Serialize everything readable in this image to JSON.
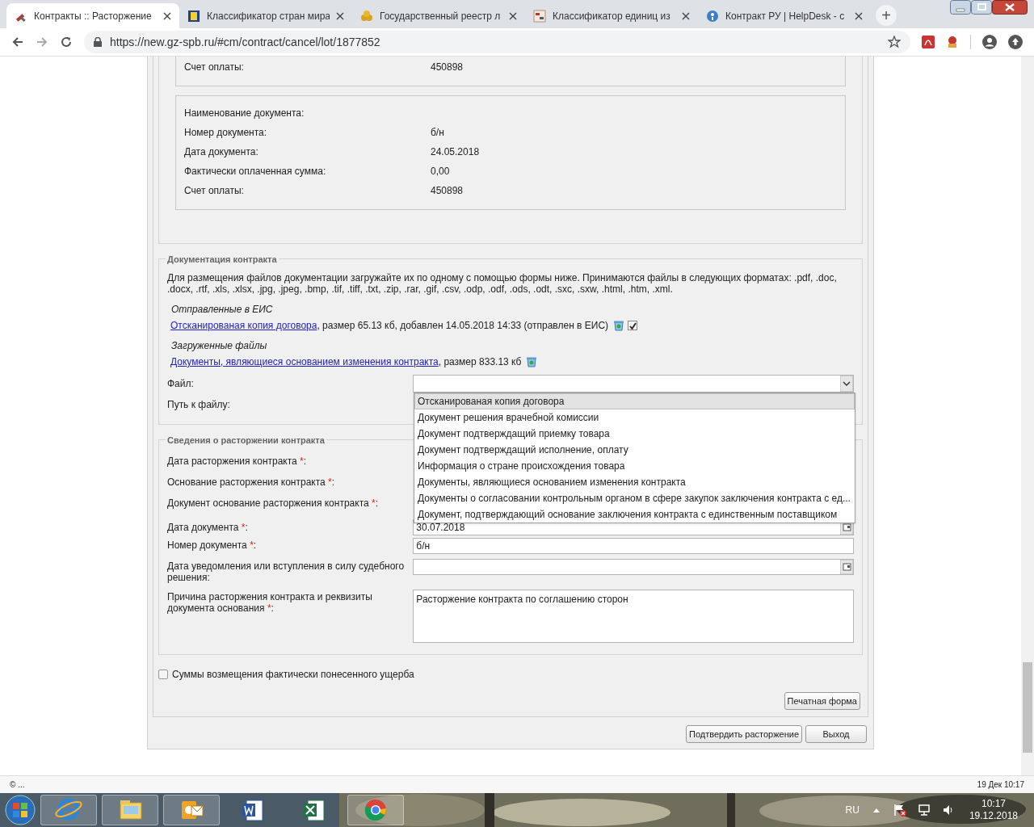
{
  "browser": {
    "tabs": [
      {
        "label": "Контракты :: Расторжение",
        "selected": true
      },
      {
        "label": "Классификатор стран мира",
        "selected": false
      },
      {
        "label": "Государственный реестр л",
        "selected": false
      },
      {
        "label": "Классификатор единиц из",
        "selected": false
      },
      {
        "label": "Контракт РУ | HelpDesk - с",
        "selected": false
      }
    ],
    "new_tab": "+",
    "url": "https://new.gz-spb.ru/#cm/contract/cancel/lot/1877852"
  },
  "payment_blocks": [
    {
      "rows": [
        {
          "label": "Счет оплаты:",
          "value": "450898"
        }
      ]
    },
    {
      "rows": [
        {
          "label": "Наименование документа:",
          "value": ""
        },
        {
          "label": "Номер документа:",
          "value": "б/н"
        },
        {
          "label": "Дата документа:",
          "value": "24.05.2018"
        },
        {
          "label": "Фактически оплаченная сумма:",
          "value": "0,00"
        },
        {
          "label": "Счет оплаты:",
          "value": "450898"
        }
      ]
    }
  ],
  "documentation": {
    "legend": "Документация контракта",
    "intro": "Для размещения файлов документации загружайте их по одному с помощью формы ниже. Принимаются файлы в следующих форматах: .pdf, .doc, .docx, .rtf, .xls, .xlsx, .jpg, .jpeg, .bmp, .tif, .tiff, .txt, .zip, .rar, .gif, .csv, .odp, .odf, .ods, .odt, .sxc, .sxw, .html, .htm, .xml.",
    "groups": [
      {
        "heading": "Отправленные в ЕИС",
        "files": [
          {
            "link": "Отсканированая копия договора",
            "details": ", размер 65.13 кб, добавлен 14.05.2018 14:33 (отправлен в ЕИС)",
            "checked": true
          }
        ]
      },
      {
        "heading": "Загруженные файлы",
        "files": [
          {
            "link": "Документы, являющиеся основанием изменения контракта",
            "details": ", размер 833.13 кб"
          }
        ]
      }
    ],
    "file_label": "Файл:",
    "path_label": "Путь к файлу:",
    "dropdown_options": [
      {
        "label": "Отсканированая копия договора",
        "selected": true
      },
      {
        "label": "Документ решения врачебной комиссии",
        "selected": false
      },
      {
        "label": "Документ подтверждащий приемку товара",
        "selected": false
      },
      {
        "label": "Документ подтверждащий исполнение, оплату",
        "selected": false
      },
      {
        "label": "Информация о стране происхождения товара",
        "selected": false
      },
      {
        "label": "Документы, являющиеся основанием изменения контракта",
        "selected": false
      },
      {
        "label": "Документы о согласовании контрольным органом в сфере закупок заключения контракта с ед...",
        "selected": false
      },
      {
        "label": "Документ, подтверждающий основание заключения контракта с единственным поставщиком",
        "selected": false
      }
    ]
  },
  "termination": {
    "legend": "Сведения о расторжении контракта",
    "fields": [
      {
        "label": "Дата расторжения контракта ",
        "required_mark": "*",
        "label_end": ":"
      },
      {
        "label": "Основание расторжения контракта ",
        "required_mark": "*",
        "label_end": ":"
      },
      {
        "label": "Документ основание расторжения контракта ",
        "required_mark": "*",
        "label_end": ":"
      },
      {
        "label": "Дата документа ",
        "required_mark": "*",
        "label_end": ":",
        "kind": "date",
        "value": "30.07.2018"
      },
      {
        "label": "Номер документа ",
        "required_mark": "*",
        "label_end": ":",
        "kind": "text",
        "value": "б/н"
      },
      {
        "label": "Дата уведомления или вступления в силу судебного решения:",
        "kind": "date"
      },
      {
        "label": "Причина расторжения контракта и реквизиты документа основания ",
        "required_mark": "*",
        "label_end": ":",
        "kind": "textarea",
        "value": "Расторжение контракта по соглашению сторон"
      }
    ]
  },
  "damages_checkbox": {
    "label": "Суммы возмещения фактически понесенного ущерба",
    "checked": false
  },
  "print_button": "Печатная форма",
  "buttons": [
    "Подтвердить расторжение",
    "Выход"
  ],
  "status_bar": {
    "left": "© ...",
    "right": "19 Дек 10:17"
  },
  "taskbar": {
    "language": "RU",
    "time": "10:17",
    "date": "19.12.2018"
  }
}
